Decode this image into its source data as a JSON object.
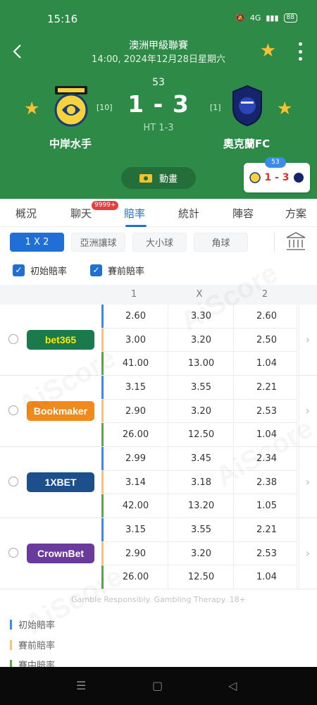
{
  "status": {
    "time": "15:16",
    "battery": "88",
    "signal": "4G"
  },
  "header": {
    "league": "澳洲甲級聯賽",
    "datetime": "14:00, 2024年12月28日星期六",
    "minute": "53",
    "score": "1 - 3",
    "ht": "HT 1-3",
    "home": {
      "name": "中岸水手",
      "rank": "[10]"
    },
    "away": {
      "name": "奧克蘭FC",
      "rank": "[1]"
    },
    "animation_label": "動畫",
    "mini": {
      "minute": "53",
      "score": "1 - 3"
    }
  },
  "tabs": [
    {
      "label": "概況"
    },
    {
      "label": "聊天"
    },
    {
      "label": "賠率"
    },
    {
      "label": "統計"
    },
    {
      "label": "陣容"
    },
    {
      "label": "方案"
    }
  ],
  "chat_badge": "9999+",
  "filters": [
    "1 X 2",
    "亞洲讓球",
    "大小球",
    "角球"
  ],
  "checks": [
    "初始賠率",
    "賽前賠率"
  ],
  "columns": [
    "1",
    "X",
    "2"
  ],
  "bookmakers": [
    {
      "name": "bet365",
      "color": "#1a7a4c",
      "text_color": "#ffe600",
      "rows": [
        [
          "2.60",
          "3.30",
          "2.60"
        ],
        [
          "3.00",
          "3.20",
          "2.50"
        ],
        [
          "41.00",
          "13.00",
          "1.04"
        ]
      ]
    },
    {
      "name": "Bookmaker",
      "color": "#f08a1c",
      "text_color": "#ffffff",
      "rows": [
        [
          "3.15",
          "3.55",
          "2.21"
        ],
        [
          "2.90",
          "3.20",
          "2.53"
        ],
        [
          "26.00",
          "12.50",
          "1.04"
        ]
      ]
    },
    {
      "name": "1XBET",
      "color": "#1c4f8c",
      "text_color": "#ffffff",
      "rows": [
        [
          "2.99",
          "3.45",
          "2.34"
        ],
        [
          "3.14",
          "3.18",
          "2.38"
        ],
        [
          "42.00",
          "13.20",
          "1.05"
        ]
      ]
    },
    {
      "name": "CrownBet",
      "color": "#6a3a9c",
      "text_color": "#ffffff",
      "rows": [
        [
          "3.15",
          "3.55",
          "2.21"
        ],
        [
          "2.90",
          "3.20",
          "2.53"
        ],
        [
          "26.00",
          "12.50",
          "1.04"
        ]
      ]
    }
  ],
  "row_colors": [
    "#3b8be8",
    "#f5c27a",
    "#5aa84a"
  ],
  "disclaimer": "Gamble Responsibly. Gambling Therapy. 18+",
  "legend": [
    "初始賠率",
    "賽前賠率",
    "賽中賠率"
  ],
  "watermark": "AiScore"
}
